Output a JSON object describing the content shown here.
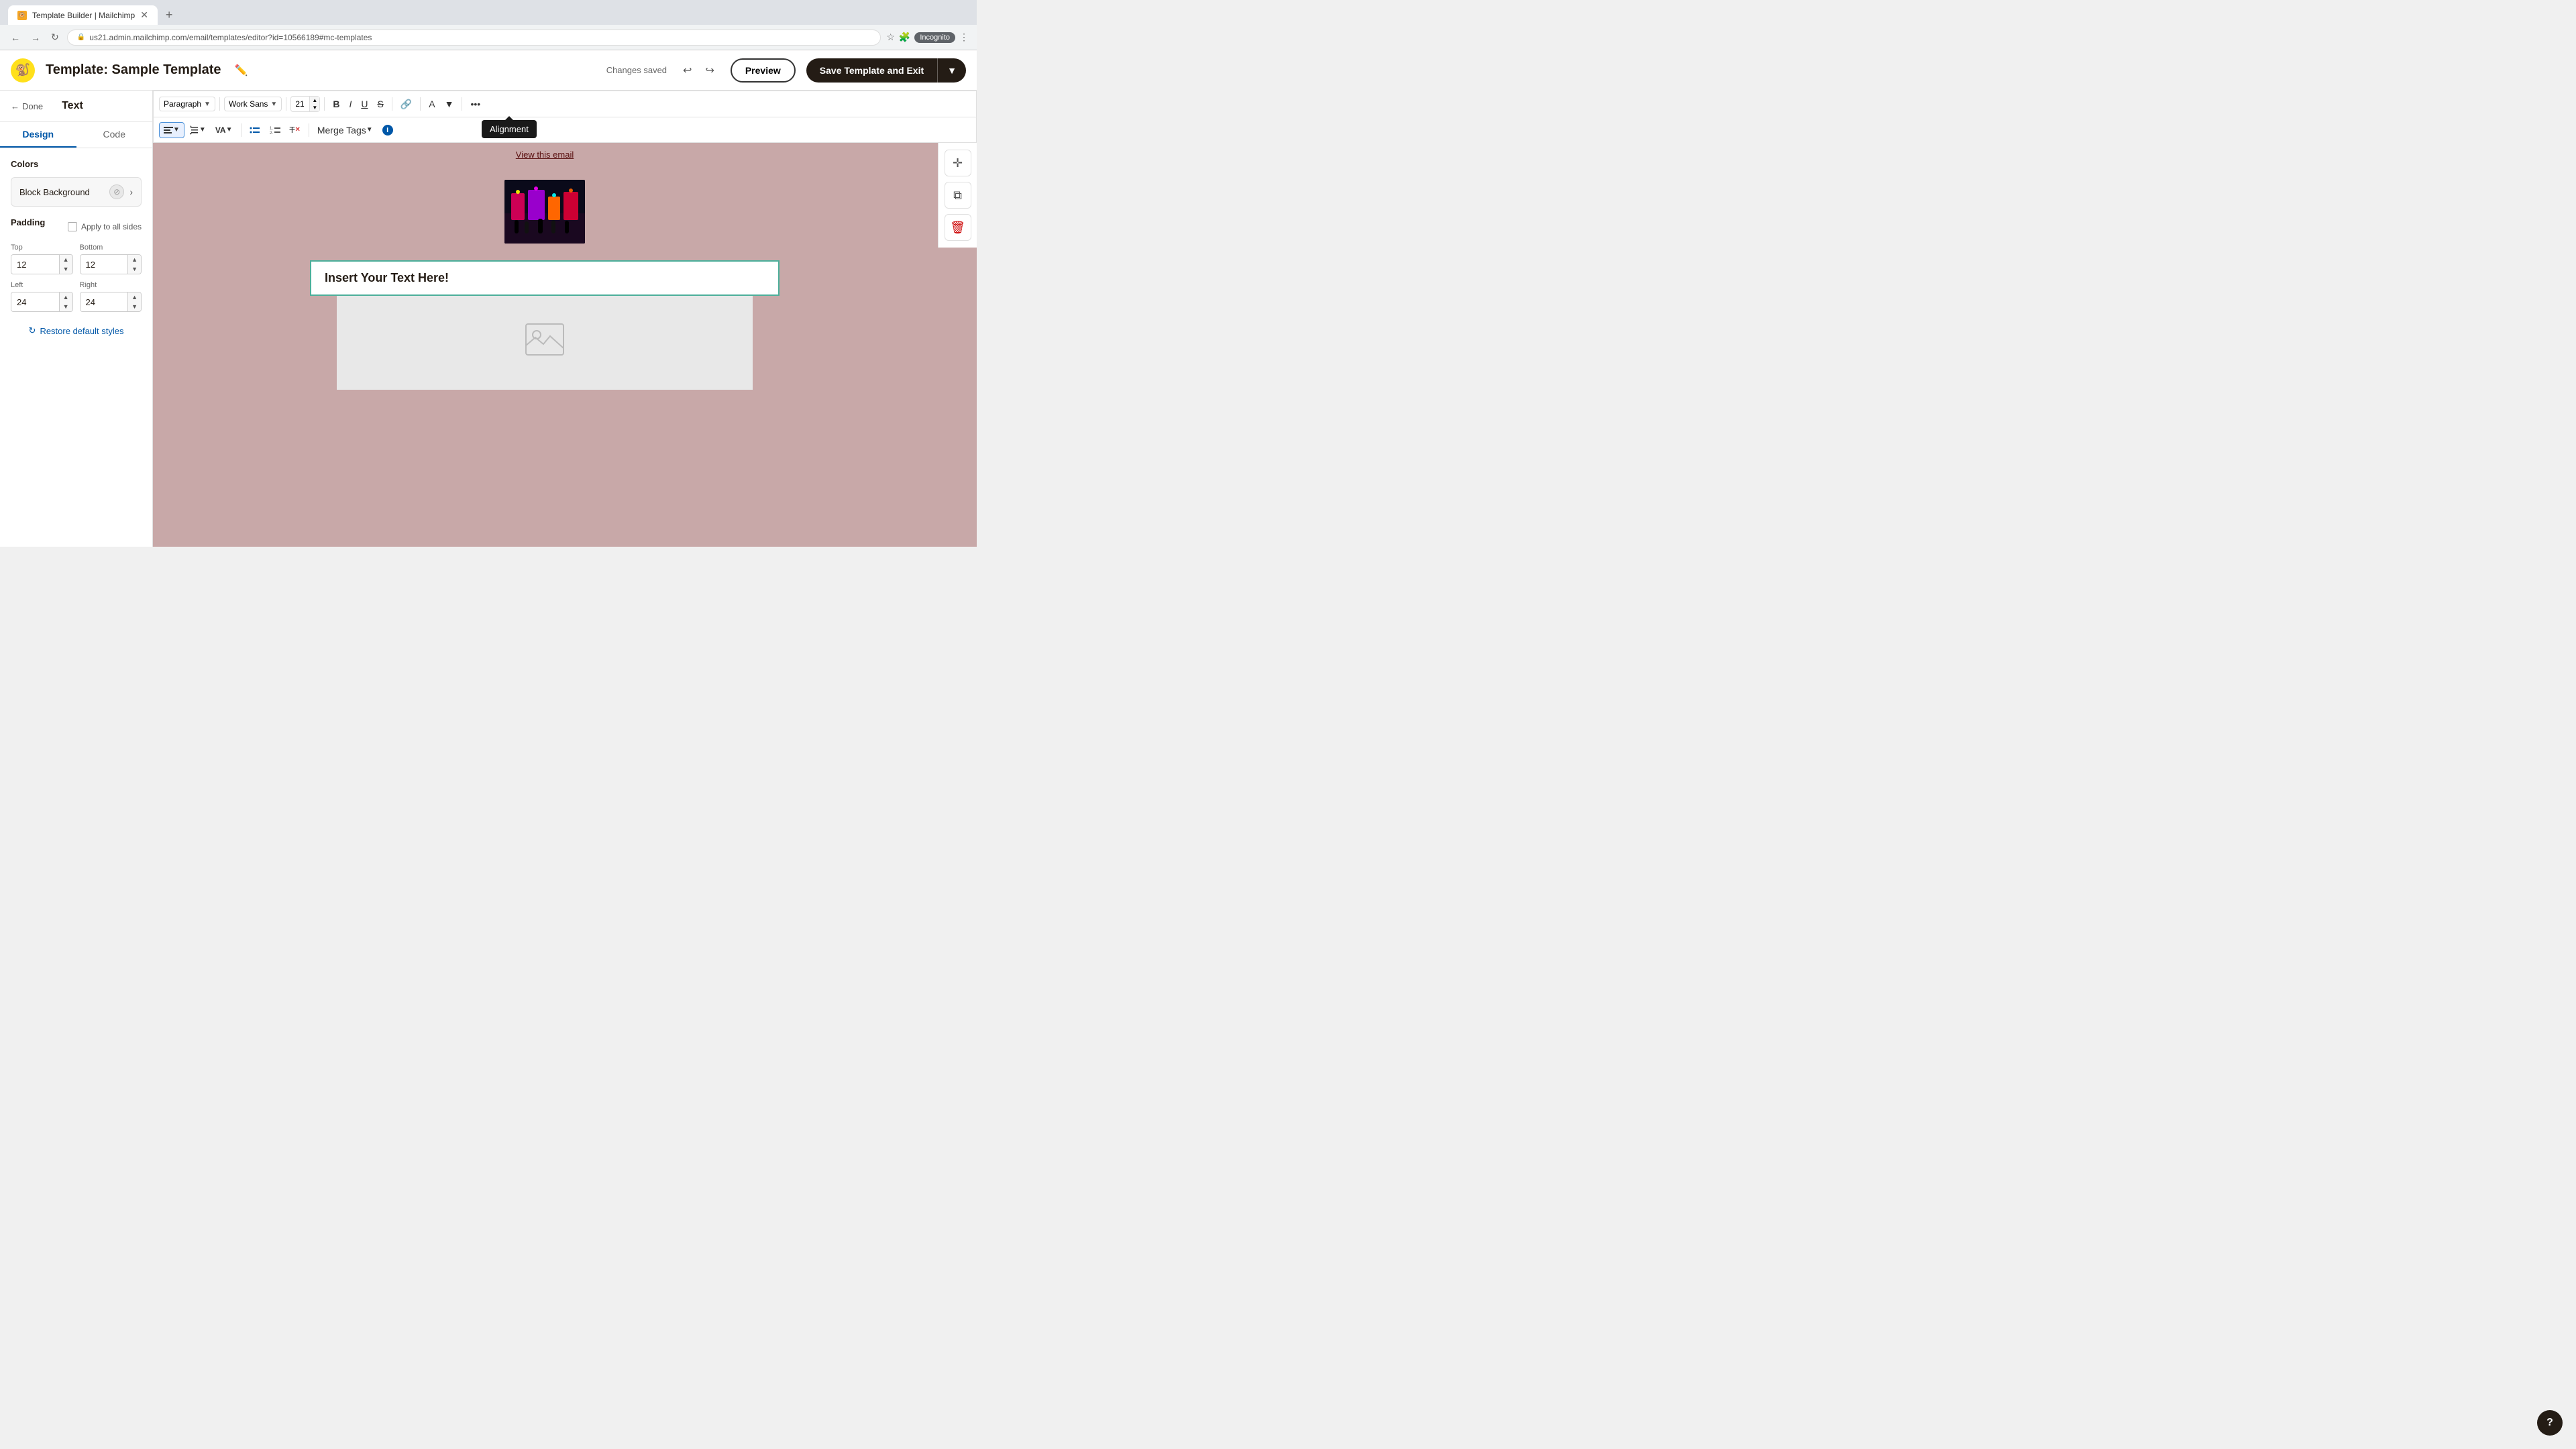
{
  "browser": {
    "tab_title": "Template Builder | Mailchimp",
    "url": "us21.admin.mailchimp.com/email/templates/editor?id=10566189#mc-templates",
    "new_tab_label": "+",
    "incognito_label": "Incognito"
  },
  "header": {
    "template_name": "Template: Sample Template",
    "changes_saved": "Changes saved",
    "preview_label": "Preview",
    "save_label": "Save Template and Exit"
  },
  "sidebar": {
    "done_label": "Done",
    "title": "Text",
    "tab_design": "Design",
    "tab_code": "Code",
    "colors_section": "Colors",
    "block_background_label": "Block Background",
    "padding_section": "Padding",
    "apply_all_label": "Apply to all sides",
    "top_label": "Top",
    "top_value": "12",
    "bottom_label": "Bottom",
    "bottom_value": "12",
    "left_label": "Left",
    "left_value": "24",
    "right_label": "Right",
    "right_value": "24",
    "restore_label": "Restore default styles"
  },
  "toolbar": {
    "paragraph_label": "Paragraph",
    "font_label": "Work Sans",
    "font_size": "21",
    "alignment_tooltip": "Alignment",
    "merge_tags_label": "Merge Tags"
  },
  "canvas": {
    "view_email_text": "View this email",
    "text_block_content": "Insert Your Text Here!"
  },
  "help": {
    "label": "?"
  }
}
